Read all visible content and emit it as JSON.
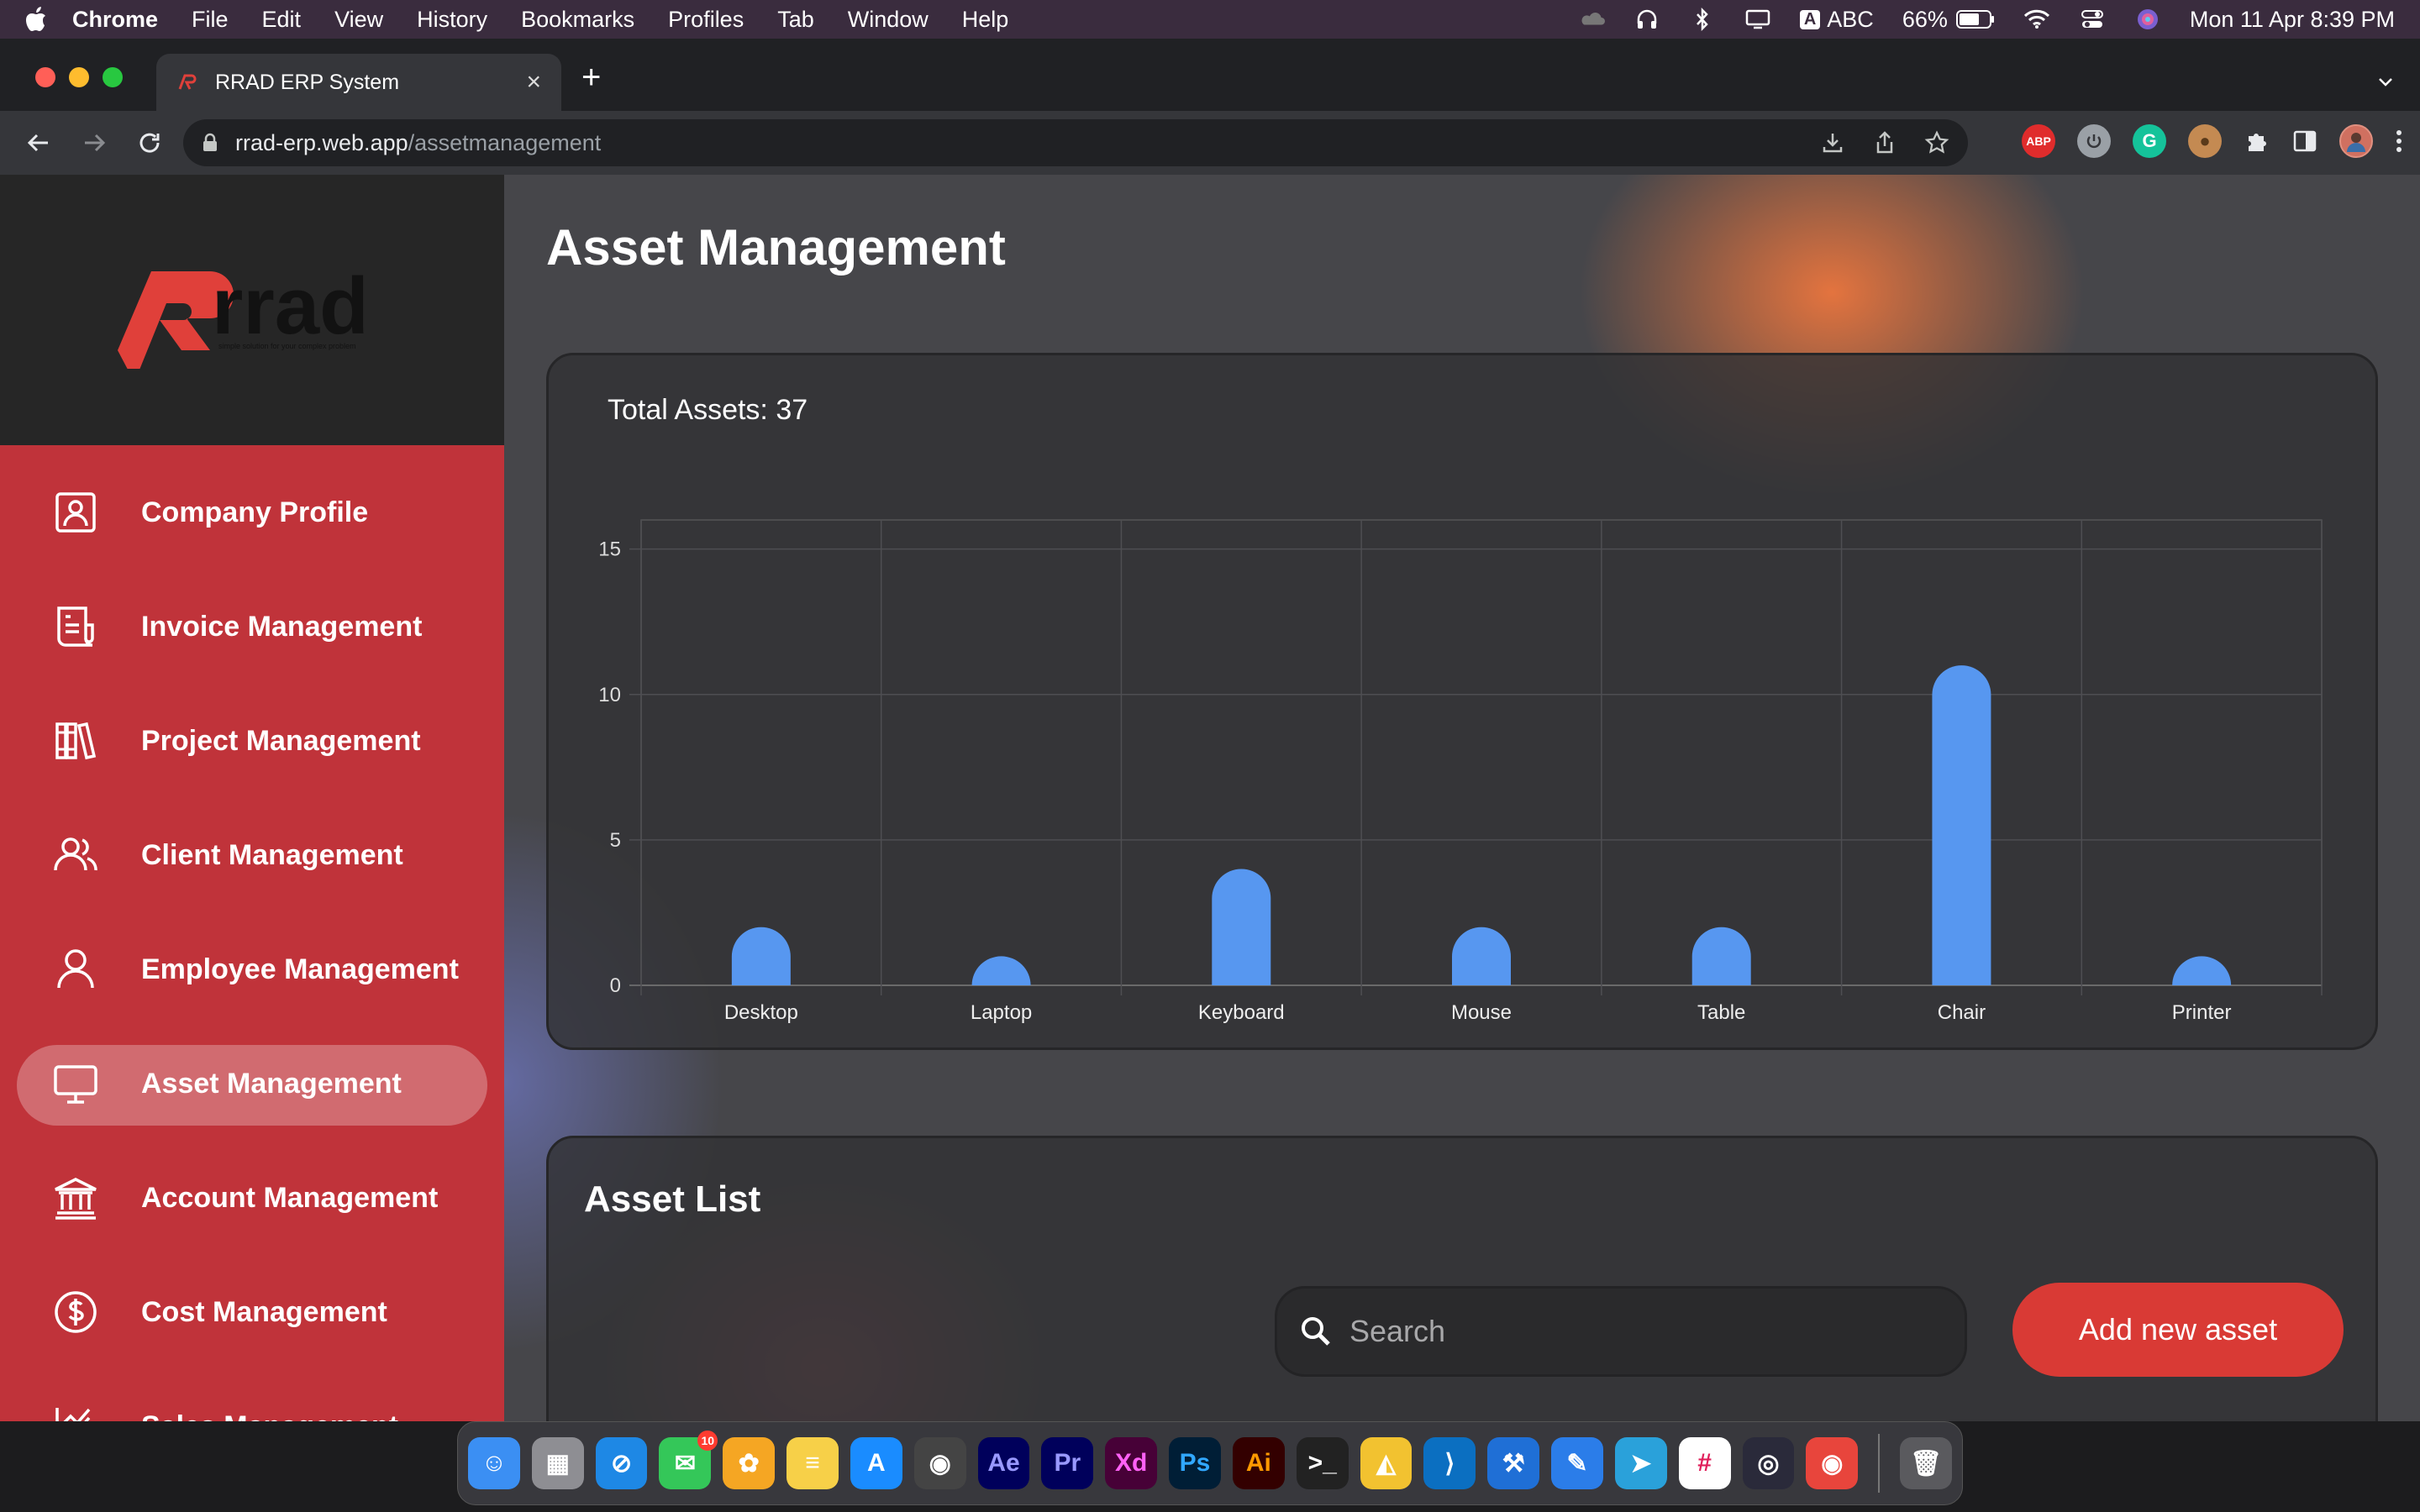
{
  "menubar": {
    "app_name": "Chrome",
    "menus": [
      "File",
      "Edit",
      "View",
      "History",
      "Bookmarks",
      "Profiles",
      "Tab",
      "Window",
      "Help"
    ],
    "input_source_badge": "A",
    "input_source": "ABC",
    "battery": "66%",
    "datetime": "Mon 11 Apr  8:39 PM"
  },
  "browser": {
    "tab_title": "RRAD ERP System",
    "url_host": "rrad-erp.web.app",
    "url_path": "/assetmanagement",
    "extension_abp": "ABP"
  },
  "sidebar": {
    "logo_text": "rrad",
    "logo_tagline": "simple solution for your complex problem",
    "items": [
      {
        "label": "Company Profile",
        "icon": "user-badge-icon"
      },
      {
        "label": "Invoice Management",
        "icon": "invoice-icon"
      },
      {
        "label": "Project Management",
        "icon": "books-icon"
      },
      {
        "label": "Client Management",
        "icon": "users-icon"
      },
      {
        "label": "Employee Management",
        "icon": "user-icon"
      },
      {
        "label": "Asset Management",
        "icon": "monitor-icon"
      },
      {
        "label": "Account Management",
        "icon": "bank-icon"
      },
      {
        "label": "Cost Management",
        "icon": "dollar-circle-icon"
      },
      {
        "label": "Sales Management",
        "icon": "chart-line-icon"
      }
    ],
    "active_index": 5
  },
  "main": {
    "page_title": "Asset Management",
    "total_assets": "Total Assets: 37",
    "list_title": "Asset List",
    "search_placeholder": "Search",
    "add_button": "Add new asset"
  },
  "chart_data": {
    "type": "bar",
    "categories": [
      "Desktop",
      "Laptop",
      "Keyboard",
      "Mouse",
      "Table",
      "Chair",
      "Printer"
    ],
    "values": [
      2,
      1,
      4,
      2,
      2,
      11,
      1
    ],
    "ylim": [
      0,
      16
    ],
    "yticks": [
      0,
      5,
      10,
      15
    ],
    "bar_color": "#5797f0",
    "grid": true
  },
  "dock": {
    "apps": [
      {
        "name": "finder-icon",
        "color": "#3b8ff3",
        "glyph": "☺"
      },
      {
        "name": "launchpad-icon",
        "color": "#8e8e93",
        "glyph": "▦"
      },
      {
        "name": "safari-icon",
        "color": "#1e88e5",
        "glyph": "⊘"
      },
      {
        "name": "messages-icon",
        "color": "#34c759",
        "glyph": "✉",
        "badge": "10"
      },
      {
        "name": "photos-icon",
        "color": "#f5a623",
        "glyph": "✿"
      },
      {
        "name": "notes-icon",
        "color": "#f7d048",
        "glyph": "≡"
      },
      {
        "name": "app-store-icon",
        "color": "#1a8cff",
        "glyph": "A"
      },
      {
        "name": "davinci-resolve-icon",
        "color": "#444",
        "glyph": "◉"
      },
      {
        "name": "after-effects-icon",
        "color": "#00005b",
        "glyph": "Ae"
      },
      {
        "name": "premiere-pro-icon",
        "color": "#00005b",
        "glyph": "Pr"
      },
      {
        "name": "xd-icon",
        "color": "#470137",
        "glyph": "Xd"
      },
      {
        "name": "photoshop-icon",
        "color": "#001e36",
        "glyph": "Ps"
      },
      {
        "name": "illustrator-icon",
        "color": "#330000",
        "glyph": "Ai"
      },
      {
        "name": "terminal-icon",
        "color": "#222",
        "glyph": ">_"
      },
      {
        "name": "android-studio-icon",
        "color": "#f2c230",
        "glyph": "◭"
      },
      {
        "name": "vscode-icon",
        "color": "#0b6fc1",
        "glyph": "⟩"
      },
      {
        "name": "xcode-icon",
        "color": "#1f6fd6",
        "glyph": "⚒"
      },
      {
        "name": "xcode-alt-icon",
        "color": "#2b7de9",
        "glyph": "✎"
      },
      {
        "name": "telegram-icon",
        "color": "#2aa1da",
        "glyph": "➤"
      },
      {
        "name": "slack-icon",
        "color": "#fff",
        "glyph": "#"
      },
      {
        "name": "obs-icon",
        "color": "#2a2a3a",
        "glyph": "◎"
      },
      {
        "name": "chrome-icon",
        "color": "#e8453c",
        "glyph": "◉"
      },
      {
        "name": "trash-icon",
        "color": "#5a5a5e",
        "glyph": "🗑"
      }
    ]
  }
}
